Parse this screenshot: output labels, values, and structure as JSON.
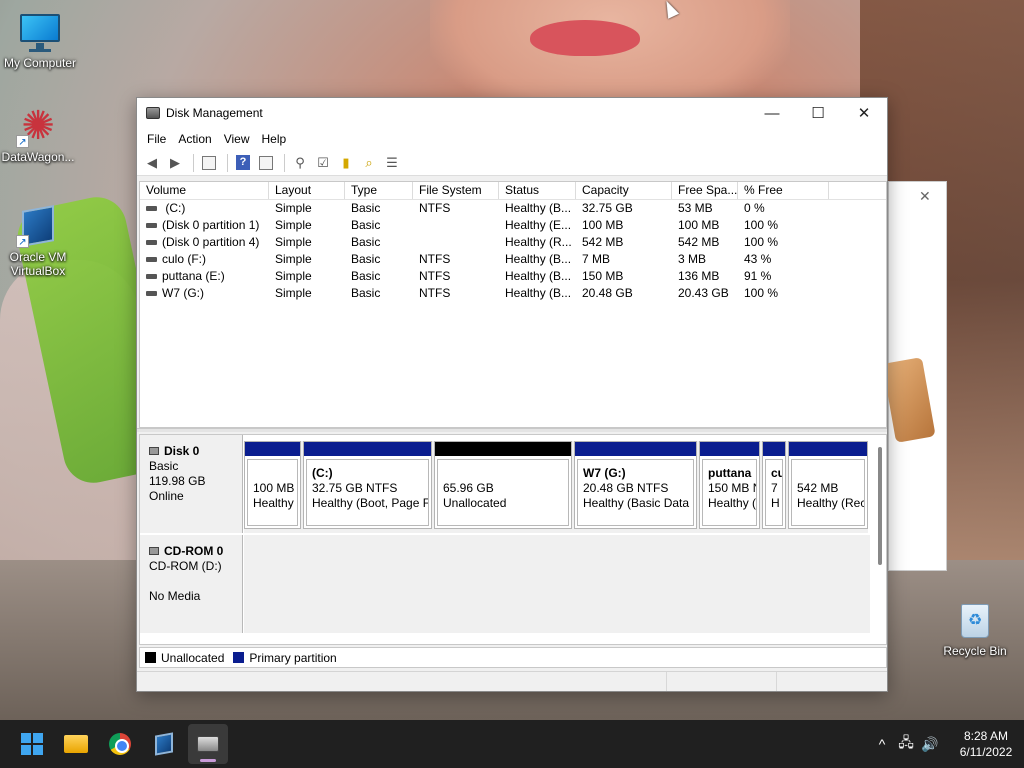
{
  "desktop": {
    "icons": [
      {
        "label": "My Computer",
        "icon": "monitor-icon"
      },
      {
        "label": "DataWagon...",
        "icon": "datawagon-icon"
      },
      {
        "label": "Oracle VM VirtualBox",
        "icon": "virtualbox-icon"
      },
      {
        "label": "Recycle Bin",
        "icon": "recycle-bin-icon"
      }
    ]
  },
  "window": {
    "title": "Disk Management",
    "controls": {
      "minimize": "—",
      "maximize": "☐",
      "close": "✕"
    },
    "menu": [
      "File",
      "Action",
      "View",
      "Help"
    ],
    "toolbar_icons": [
      "back-icon",
      "forward-icon",
      "properties-icon",
      "help-icon",
      "console-tree-icon",
      "connect-icon",
      "check-icon",
      "open-icon",
      "search-icon",
      "list-icon"
    ]
  },
  "volumes": {
    "columns": [
      "Volume",
      "Layout",
      "Type",
      "File System",
      "Status",
      "Capacity",
      "Free Spa...",
      "% Free"
    ],
    "rows": [
      {
        "volume": " (C:)",
        "layout": "Simple",
        "type": "Basic",
        "fs": "NTFS",
        "status": "Healthy (B...",
        "capacity": "32.75 GB",
        "free": "53 MB",
        "pct": "0 %"
      },
      {
        "volume": "(Disk 0 partition 1)",
        "layout": "Simple",
        "type": "Basic",
        "fs": "",
        "status": "Healthy (E...",
        "capacity": "100 MB",
        "free": "100 MB",
        "pct": "100 %"
      },
      {
        "volume": "(Disk 0 partition 4)",
        "layout": "Simple",
        "type": "Basic",
        "fs": "",
        "status": "Healthy (R...",
        "capacity": "542 MB",
        "free": "542 MB",
        "pct": "100 %"
      },
      {
        "volume": "culo (F:)",
        "layout": "Simple",
        "type": "Basic",
        "fs": "NTFS",
        "status": "Healthy (B...",
        "capacity": "7 MB",
        "free": "3 MB",
        "pct": "43 %"
      },
      {
        "volume": "puttana (E:)",
        "layout": "Simple",
        "type": "Basic",
        "fs": "NTFS",
        "status": "Healthy (B...",
        "capacity": "150 MB",
        "free": "136 MB",
        "pct": "91 %"
      },
      {
        "volume": "W7 (G:)",
        "layout": "Simple",
        "type": "Basic",
        "fs": "NTFS",
        "status": "Healthy (B...",
        "capacity": "20.48 GB",
        "free": "20.43 GB",
        "pct": "100 %"
      }
    ]
  },
  "disks": {
    "disk0": {
      "name": "Disk 0",
      "type": "Basic",
      "size": "119.98 GB",
      "state": "Online",
      "partitions": [
        {
          "name": "",
          "line1": "100 MB",
          "line2": "Healthy",
          "kind": "primary"
        },
        {
          "name": "(C:)",
          "line1": "32.75 GB NTFS",
          "line2": "Healthy (Boot, Page F",
          "kind": "primary"
        },
        {
          "name": "",
          "line1": "65.96 GB",
          "line2": "Unallocated",
          "kind": "unallocated"
        },
        {
          "name": "W7  (G:)",
          "line1": "20.48 GB NTFS",
          "line2": "Healthy (Basic Data F",
          "kind": "primary"
        },
        {
          "name": "puttana",
          "line1": "150 MB N",
          "line2": "Healthy (",
          "kind": "primary"
        },
        {
          "name": "cu",
          "line1": "7",
          "line2": "H",
          "kind": "primary"
        },
        {
          "name": "",
          "line1": "542 MB",
          "line2": "Healthy (Rec",
          "kind": "primary"
        }
      ]
    },
    "cdrom0": {
      "name": "CD-ROM 0",
      "type": "CD-ROM (D:)",
      "state": "No Media"
    }
  },
  "legend": [
    {
      "label": "Unallocated",
      "color": "#000000"
    },
    {
      "label": "Primary partition",
      "color": "#0a1d8f"
    }
  ],
  "taskbar": {
    "apps": [
      "start-icon",
      "file-explorer-icon",
      "chrome-icon",
      "virtualbox-icon",
      "disk-management-icon"
    ],
    "tray": {
      "chevron": "^",
      "network": "🖧",
      "volume": "🔊"
    },
    "time": "8:28 AM",
    "date": "6/11/2022"
  }
}
